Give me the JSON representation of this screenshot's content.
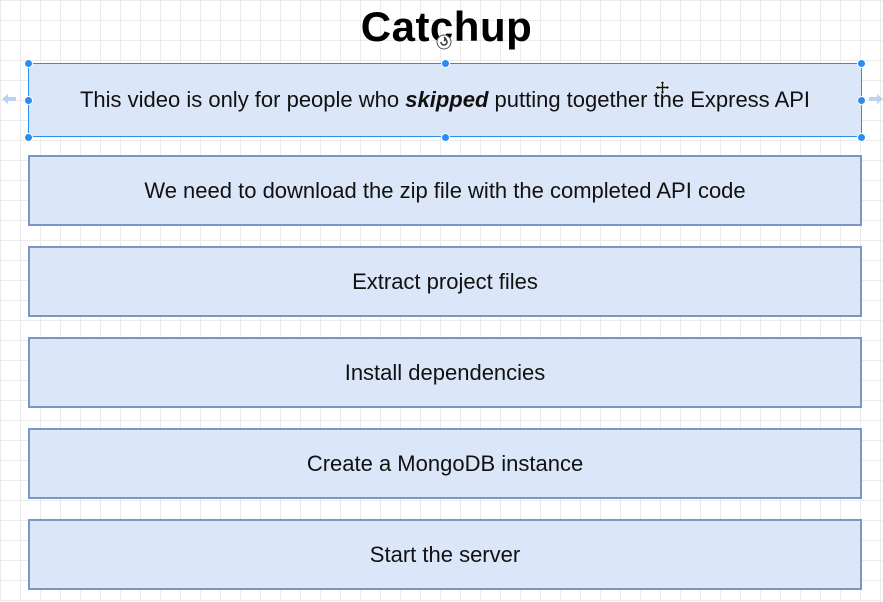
{
  "title": "Catchup",
  "steps": [
    {
      "text_before": "This video is only for people who ",
      "text_emphasis": "skipped",
      "text_after": " putting together the Express API"
    },
    {
      "text": "We need to download the zip file with the completed API code"
    },
    {
      "text": "Extract project files"
    },
    {
      "text": "Install dependencies"
    },
    {
      "text": "Create a MongoDB instance"
    },
    {
      "text": "Start the server"
    }
  ],
  "colors": {
    "box_fill": "#dbe6f8",
    "box_border": "#7a96c4",
    "selection_accent": "#2b8df0",
    "grid_line": "#ebebeb"
  },
  "icons": [
    "rotate-handle-icon",
    "move-cursor-icon",
    "connect-arrow-left-icon",
    "connect-arrow-right-icon"
  ]
}
